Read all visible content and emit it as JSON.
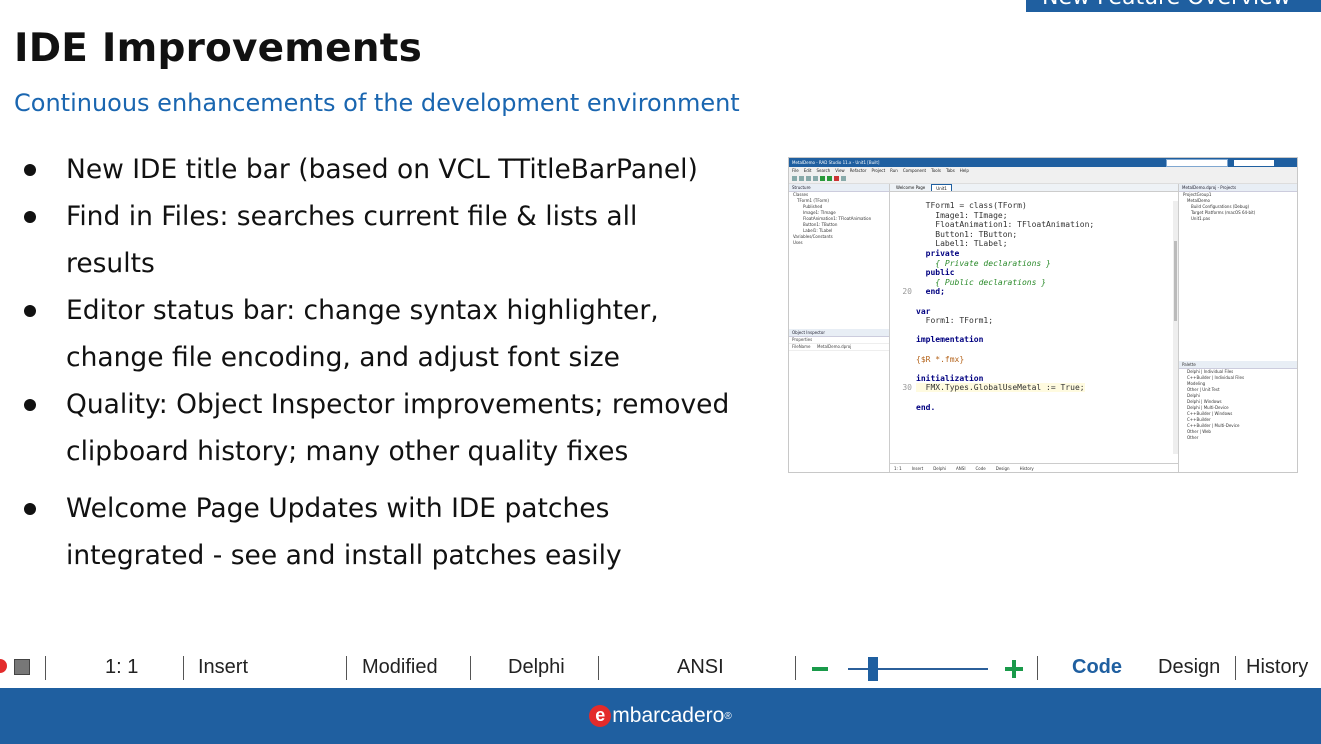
{
  "badge": "New Feature Overview",
  "title": "IDE Improvements",
  "subtitle": "Continuous enhancements of the development environment",
  "bullets": [
    "New IDE title bar (based on VCL TTitleBarPanel)",
    "Find in Files: searches current file & lists all results",
    "Editor status bar: change syntax highlighter, change file encoding, and adjust font size",
    "Quality: Object Inspector improvements; removed clipboard history; many other quality fixes",
    "Welcome Page Updates with IDE patches integrated - see and install patches easily"
  ],
  "ide": {
    "window_title": "MetalDemo - RAD Studio 11.x - Unit1 [Built]",
    "layout": "Default Layout",
    "menu": [
      "File",
      "Edit",
      "Search",
      "View",
      "Refactor",
      "Project",
      "Run",
      "Component",
      "Tools",
      "Tabs",
      "Help"
    ],
    "structure_title": "Structure",
    "structure_tree": [
      "Classes",
      "TForm1 (TForm)",
      "Published",
      "Image1: TImage",
      "FloatAnimation1: TFloatAnimation",
      "Button1: TButton",
      "Label1: TLabel",
      "Variables/Constants",
      "Uses"
    ],
    "oi_title": "Object Inspector",
    "oi_rows": [
      [
        "Properties",
        ""
      ],
      [
        "FileName",
        "MetalDemo.dproj"
      ]
    ],
    "tabs": [
      "Welcome Page",
      "Unit1"
    ],
    "code_lines": [
      {
        "n": "",
        "t": "  TForm1 = class(TForm)"
      },
      {
        "n": "",
        "t": "    Image1: TImage;"
      },
      {
        "n": "",
        "t": "    FloatAnimation1: TFloatAnimation;"
      },
      {
        "n": "",
        "t": "    Button1: TButton;"
      },
      {
        "n": "",
        "t": "    Label1: TLabel;"
      },
      {
        "n": "",
        "t": "  private"
      },
      {
        "n": "",
        "t": "    { Private declarations }"
      },
      {
        "n": "",
        "t": "  public"
      },
      {
        "n": "",
        "t": "    { Public declarations }"
      },
      {
        "n": "20",
        "t": "  end;"
      },
      {
        "n": "",
        "t": ""
      },
      {
        "n": "",
        "t": "var"
      },
      {
        "n": "",
        "t": "  Form1: TForm1;"
      },
      {
        "n": "",
        "t": ""
      },
      {
        "n": "",
        "t": "implementation"
      },
      {
        "n": "",
        "t": ""
      },
      {
        "n": "",
        "t": "{$R *.fmx}"
      },
      {
        "n": "",
        "t": ""
      },
      {
        "n": "",
        "t": "initialization"
      },
      {
        "n": "30",
        "t": "  FMX.Types.GlobalUseMetal := True;"
      },
      {
        "n": "",
        "t": ""
      },
      {
        "n": "",
        "t": "end."
      }
    ],
    "projects_title": "MetalDemo.dproj - Projects",
    "projects_tree": [
      "ProjectGroup1",
      "MetalDemo",
      "Build Configurations (Debug)",
      "Target Platforms (macOS 64-bit)",
      "Unit1.pas"
    ],
    "palette_title": "Palette",
    "palette_items": [
      "Delphi | Individual Files",
      "C++Builder | Individual Files",
      "Modeling",
      "Other | Unit Test",
      "Delphi",
      "Delphi | Windows",
      "Delphi | Multi-Device",
      "C++Builder | Windows",
      "C++Builder",
      "C++Builder | Multi-Device",
      "Other | Web",
      "Other"
    ],
    "mini_status": [
      "1: 1",
      "Insert",
      "Delphi",
      "ANSI",
      "Code",
      "Design",
      "History"
    ]
  },
  "statusbar": {
    "position": "1: 1",
    "mode": "Insert",
    "modified": "Modified",
    "language": "Delphi",
    "encoding": "ANSI",
    "font_size_fraction": 0.17,
    "tab_code": "Code",
    "tab_design": "Design",
    "tab_history": "History"
  },
  "footer": {
    "logo_letter": "e",
    "logo_text": "mbarcadero",
    "registered": "®"
  },
  "colors": {
    "brand_blue": "#1f5fa0",
    "subtitle_blue": "#1a66b0",
    "zoom_green": "#1a9a4a",
    "logo_red": "#e32b2b"
  }
}
